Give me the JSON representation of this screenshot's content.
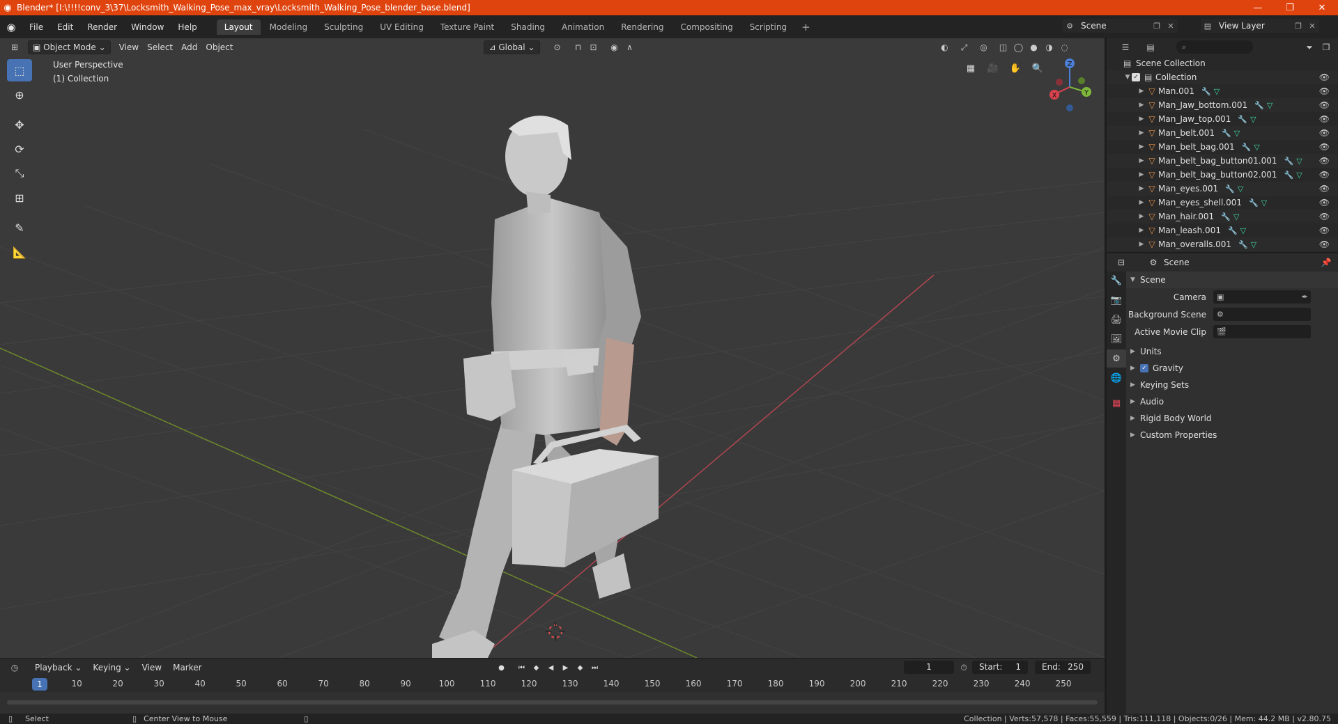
{
  "window": {
    "title": "Blender* [I:\\!!!!conv_3\\37\\Locksmith_Walking_Pose_max_vray\\Locksmith_Walking_Pose_blender_base.blend]",
    "buttons": {
      "minimize": "—",
      "maximize": "❐",
      "close": "✕"
    }
  },
  "menu": [
    "File",
    "Edit",
    "Render",
    "Window",
    "Help"
  ],
  "workspaces": [
    {
      "label": "Layout",
      "active": true
    },
    {
      "label": "Modeling"
    },
    {
      "label": "Sculpting"
    },
    {
      "label": "UV Editing"
    },
    {
      "label": "Texture Paint"
    },
    {
      "label": "Shading"
    },
    {
      "label": "Animation"
    },
    {
      "label": "Rendering"
    },
    {
      "label": "Compositing"
    },
    {
      "label": "Scripting"
    }
  ],
  "scene_selector": "Scene",
  "view_layer": "View Layer",
  "viewport": {
    "mode": "Object Mode",
    "menus": [
      "View",
      "Select",
      "Add",
      "Object"
    ],
    "transform_orientation": "Global",
    "perspective_label": "User Perspective",
    "collection_label": "(1) Collection",
    "gizmo": {
      "x": "X",
      "y": "Y",
      "z": "Z"
    },
    "colors": {
      "bg": "#3a3a3a",
      "grid": "#454545",
      "x_axis": "#b34a4f",
      "y_axis": "#7a9a2a",
      "active_tool": "#4772b3"
    }
  },
  "timeline": {
    "menus": [
      "Playback",
      "Keying",
      "View",
      "Marker"
    ],
    "current_frame": "1",
    "start_label": "Start:",
    "start": "1",
    "end_label": "End:",
    "end": "250",
    "ticks": [
      "10",
      "20",
      "30",
      "40",
      "50",
      "60",
      "70",
      "80",
      "90",
      "100",
      "110",
      "120",
      "130",
      "140",
      "150",
      "160",
      "170",
      "180",
      "190",
      "200",
      "210",
      "220",
      "230",
      "240",
      "250"
    ]
  },
  "statusbar": {
    "left1": "Select",
    "left2": "Center View to Mouse",
    "right": "Collection | Verts:57,578 | Faces:55,559 | Tris:111,118 | Objects:0/26 | Mem: 44.2 MB | v2.80.75"
  },
  "outliner": {
    "root": "Scene Collection",
    "collection": "Collection",
    "items": [
      "Man.001",
      "Man_Jaw_bottom.001",
      "Man_Jaw_top.001",
      "Man_belt.001",
      "Man_belt_bag.001",
      "Man_belt_bag_button01.001",
      "Man_belt_bag_button02.001",
      "Man_eyes.001",
      "Man_eyes_shell.001",
      "Man_hair.001",
      "Man_leash.001",
      "Man_overalls.001"
    ]
  },
  "properties": {
    "context": "Scene",
    "section": "Scene",
    "camera_label": "Camera",
    "background_scene_label": "Background Scene",
    "active_clip_label": "Active Movie Clip",
    "panels": [
      "Units",
      "Gravity",
      "Keying Sets",
      "Audio",
      "Rigid Body World",
      "Custom Properties"
    ]
  }
}
